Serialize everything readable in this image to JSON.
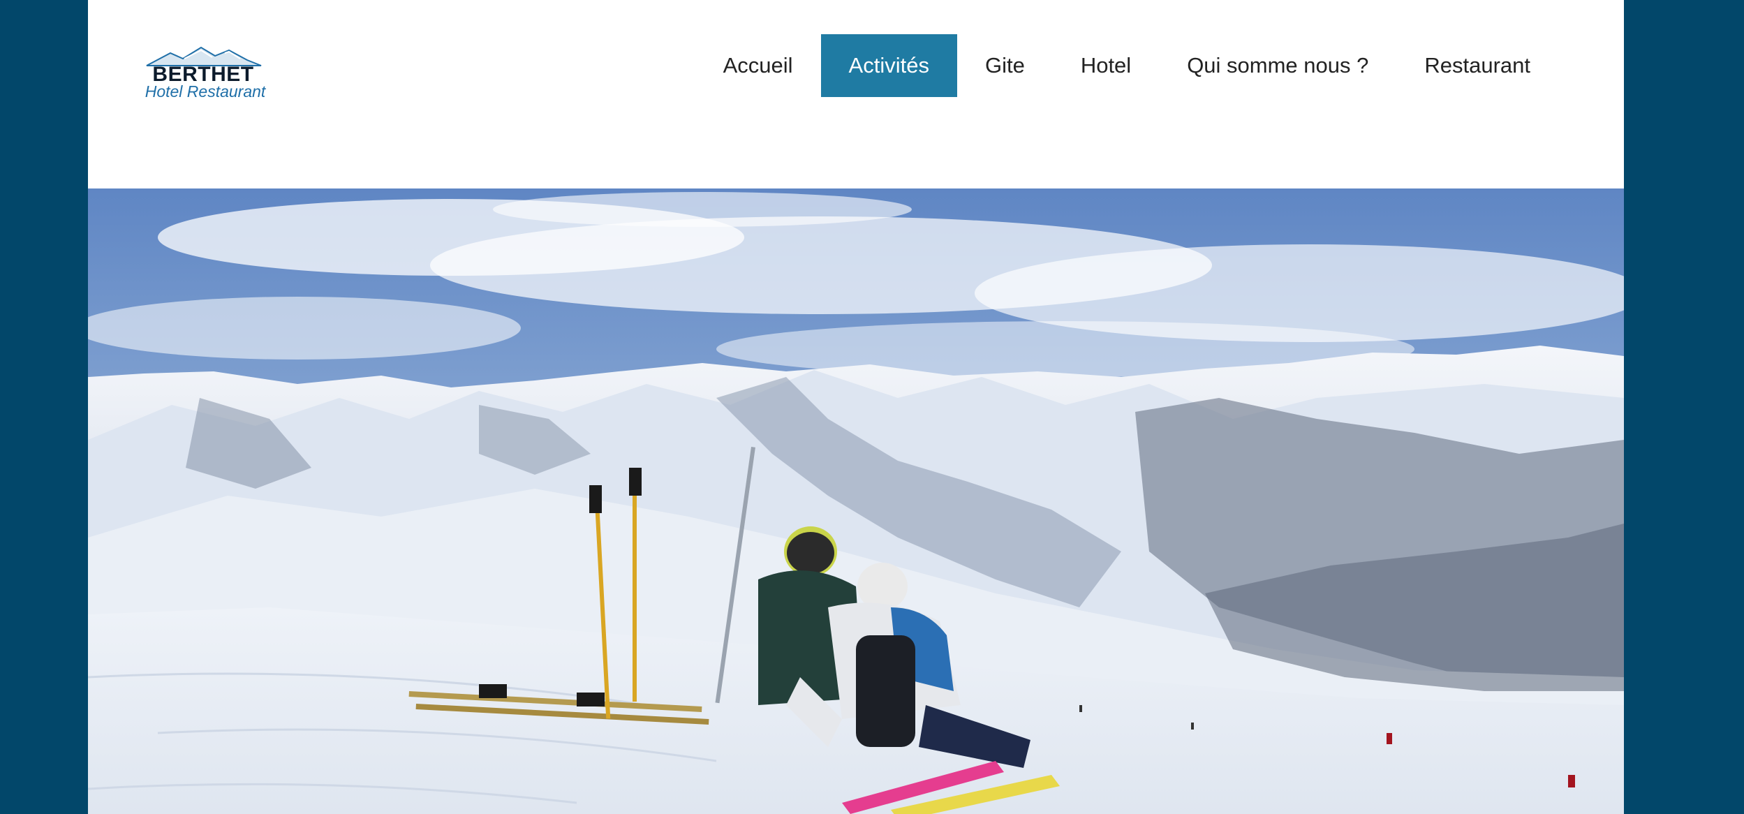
{
  "logo": {
    "name": "BERTHET",
    "subtitle": "Hotel Restaurant"
  },
  "nav": {
    "items": [
      {
        "label": "Accueil"
      },
      {
        "label": "Activités",
        "active": true
      },
      {
        "label": "Gite"
      },
      {
        "label": "Hotel"
      },
      {
        "label": "Qui somme nous ?"
      },
      {
        "label": "Restaurant"
      }
    ]
  },
  "hero": {
    "icon": "ski-mountain-photo"
  },
  "colors": {
    "page_background": "#02476a",
    "nav_active": "#1f7ba3",
    "logo_text": "#0c1b2c",
    "logo_subtitle": "#1f6fa8"
  }
}
